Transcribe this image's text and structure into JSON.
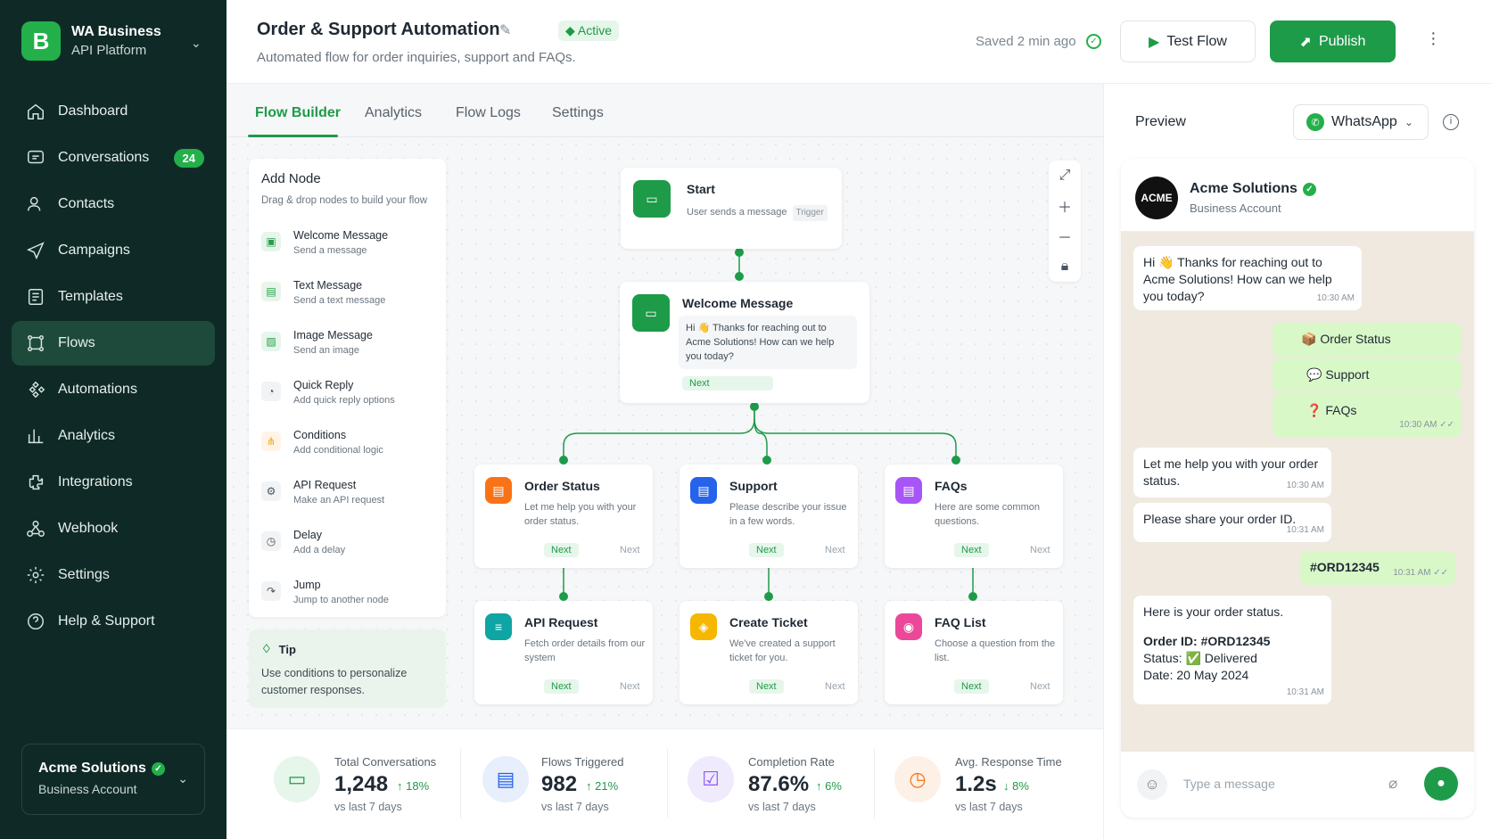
{
  "brand": {
    "logo_letter": "B",
    "name": "WA Business",
    "sub": "API Platform"
  },
  "nav": [
    {
      "label": "Dashboard",
      "icon": "home-icon"
    },
    {
      "label": "Conversations",
      "icon": "chat-icon",
      "badge": "24"
    },
    {
      "label": "Contacts",
      "icon": "contacts-icon"
    },
    {
      "label": "Campaigns",
      "icon": "send-icon"
    },
    {
      "label": "Templates",
      "icon": "template-icon"
    },
    {
      "label": "Flows",
      "icon": "flows-icon",
      "active": true
    },
    {
      "label": "Automations",
      "icon": "automation-icon"
    },
    {
      "label": "Analytics",
      "icon": "analytics-icon"
    },
    {
      "label": "Integrations",
      "icon": "puzzle-icon"
    },
    {
      "label": "Webhook",
      "icon": "webhook-icon"
    },
    {
      "label": "Settings",
      "icon": "gear-icon"
    },
    {
      "label": "Help & Support",
      "icon": "help-icon"
    }
  ],
  "account": {
    "name": "Acme Solutions",
    "sub": "Business Account"
  },
  "header": {
    "title": "Order & Support Automation",
    "status": "Active",
    "subtitle": "Automated flow for order inquiries, support and FAQs.",
    "saved": "Saved 2 min ago",
    "test_label": "Test Flow",
    "publish_label": "Publish"
  },
  "tabs": [
    "Flow Builder",
    "Analytics",
    "Flow Logs",
    "Settings"
  ],
  "add_node": {
    "title": "Add Node",
    "hint": "Drag & drop nodes to build your flow",
    "items": [
      {
        "title": "Welcome Message",
        "sub": "Send a message"
      },
      {
        "title": "Text Message",
        "sub": "Send a text message"
      },
      {
        "title": "Image Message",
        "sub": "Send an image"
      },
      {
        "title": "Quick Reply",
        "sub": "Add quick reply options"
      },
      {
        "title": "Conditions",
        "sub": "Add conditional logic"
      },
      {
        "title": "API Request",
        "sub": "Make an API request"
      },
      {
        "title": "Delay",
        "sub": "Add a delay"
      },
      {
        "title": "Jump",
        "sub": "Jump to another node"
      }
    ]
  },
  "tip": {
    "title": "Tip",
    "body": "Use conditions to personalize customer responses."
  },
  "nodes": {
    "start": {
      "title": "Start",
      "desc": "User sends a message",
      "tag": "Trigger"
    },
    "welcome": {
      "title": "Welcome Message",
      "desc": "Hi 👋 Thanks for reaching out to Acme Solutions! How can we help you today?",
      "next": "Next"
    },
    "order": {
      "title": "Order Status",
      "desc": "Let me help you with your order status.",
      "next": "Next",
      "next2": "Next",
      "color": "#f97316"
    },
    "support": {
      "title": "Support",
      "desc": "Please describe your issue in a few words.",
      "next": "Next",
      "next2": "Next",
      "color": "#2563eb"
    },
    "faqs": {
      "title": "FAQs",
      "desc": "Here are some common questions.",
      "next": "Next",
      "next2": "Next",
      "color": "#a855f7"
    },
    "api": {
      "title": "API Request",
      "desc": "Fetch order details from our system",
      "next": "Next",
      "next2": "Next",
      "color": "#0ea5a4"
    },
    "ticket": {
      "title": "Create Ticket",
      "desc": "We've created a support ticket for you.",
      "next": "Next",
      "next2": "Next",
      "color": "#f5b700"
    },
    "faqlist": {
      "title": "FAQ List",
      "desc": "Choose a question from the list.",
      "next": "Next",
      "next2": "Next",
      "color": "#ec4899"
    }
  },
  "stats": [
    {
      "label": "Total Conversations",
      "value": "1,248",
      "delta": "↑ 18%",
      "sub": "vs last 7 days",
      "color": "#1e9b49",
      "bg": "#e6f6ea"
    },
    {
      "label": "Flows Triggered",
      "value": "982",
      "delta": "↑ 21%",
      "sub": "vs last 7 days",
      "color": "#2563eb",
      "bg": "#e7eefc"
    },
    {
      "label": "Completion Rate",
      "value": "87.6%",
      "delta": "↑ 6%",
      "sub": "vs last 7 days",
      "color": "#8b5cf6",
      "bg": "#f0eafd"
    },
    {
      "label": "Avg. Response Time",
      "value": "1.2s",
      "delta": "↓ 8%",
      "sub": "vs last 7 days",
      "color": "#f97316",
      "bg": "#fdf0e6"
    }
  ],
  "preview": {
    "label": "Preview",
    "channel": "WhatsApp",
    "biz_logo": "ACME",
    "biz_name": "Acme Solutions",
    "biz_sub": "Business Account",
    "messages": [
      {
        "text": "Hi 👋 Thanks for reaching out to Acme Solutions! How can we help you today?",
        "time": "10:30 AM"
      },
      {
        "text": "📦 Order Status"
      },
      {
        "text": "💬 Support"
      },
      {
        "text": "❓ FAQs",
        "time": "10:30 AM ✓✓"
      },
      {
        "text": "Let me help you with your order status.",
        "time": "10:30 AM"
      },
      {
        "text": "Please share your order ID.",
        "time": "10:31 AM"
      },
      {
        "text": "#ORD12345",
        "time": "10:31 AM ✓✓"
      },
      {
        "line1": "Here is your order status.",
        "line2": "Order ID: #ORD12345",
        "line3": "Status: ✅ Delivered",
        "line4": "Date: 20 May 2024",
        "time": "10:31 AM"
      }
    ],
    "input_placeholder": "Type a message"
  }
}
